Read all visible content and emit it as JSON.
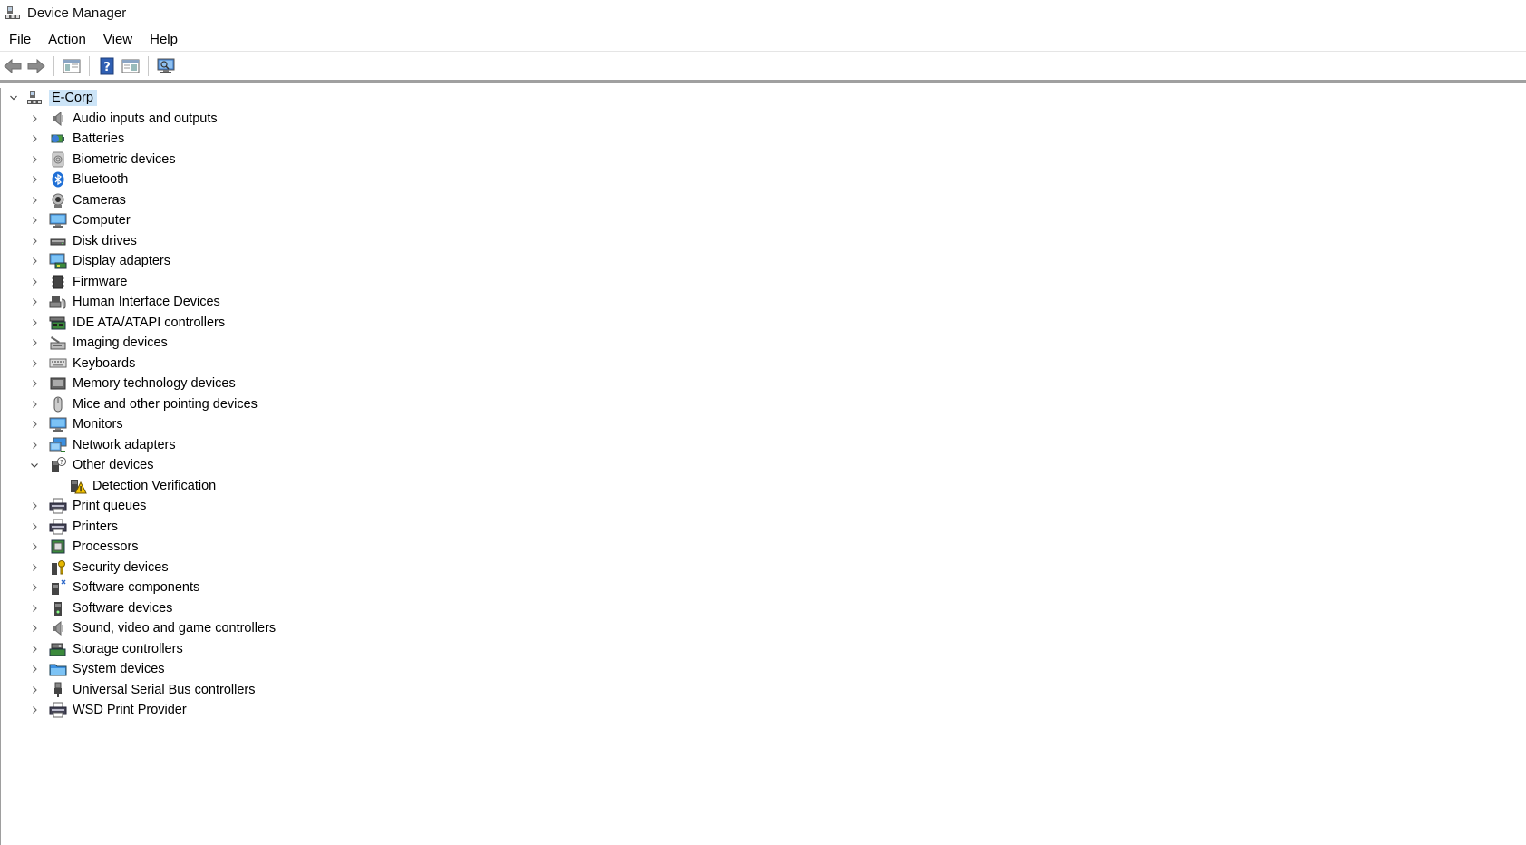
{
  "window": {
    "title": "Device Manager"
  },
  "menu": [
    "File",
    "Action",
    "View",
    "Help"
  ],
  "toolbar": {
    "buttons": [
      "back-icon",
      "forward-icon",
      "show-hide-console-tree-icon",
      "help-icon",
      "properties-icon",
      "scan-hardware-icon"
    ]
  },
  "tree": {
    "root": {
      "label": "E-Corp",
      "expanded": true,
      "icon": "computer-network-icon"
    },
    "categories": [
      {
        "label": "Audio inputs and outputs",
        "icon": "speaker-icon",
        "expanded": false
      },
      {
        "label": "Batteries",
        "icon": "battery-icon",
        "expanded": false
      },
      {
        "label": "Biometric devices",
        "icon": "fingerprint-icon",
        "expanded": false
      },
      {
        "label": "Bluetooth",
        "icon": "bluetooth-icon",
        "expanded": false
      },
      {
        "label": "Cameras",
        "icon": "camera-icon",
        "expanded": false
      },
      {
        "label": "Computer",
        "icon": "monitor-icon",
        "expanded": false
      },
      {
        "label": "Disk drives",
        "icon": "disk-drive-icon",
        "expanded": false
      },
      {
        "label": "Display adapters",
        "icon": "display-adapter-icon",
        "expanded": false
      },
      {
        "label": "Firmware",
        "icon": "chip-icon",
        "expanded": false
      },
      {
        "label": "Human Interface Devices",
        "icon": "hid-icon",
        "expanded": false
      },
      {
        "label": "IDE ATA/ATAPI controllers",
        "icon": "ide-controller-icon",
        "expanded": false
      },
      {
        "label": "Imaging devices",
        "icon": "scanner-icon",
        "expanded": false
      },
      {
        "label": "Keyboards",
        "icon": "keyboard-icon",
        "expanded": false
      },
      {
        "label": "Memory technology devices",
        "icon": "memory-icon",
        "expanded": false
      },
      {
        "label": "Mice and other pointing devices",
        "icon": "mouse-icon",
        "expanded": false
      },
      {
        "label": "Monitors",
        "icon": "monitor-icon",
        "expanded": false
      },
      {
        "label": "Network adapters",
        "icon": "network-icon",
        "expanded": false
      },
      {
        "label": "Other devices",
        "icon": "unknown-device-icon",
        "expanded": true,
        "children": [
          {
            "label": "Detection Verification",
            "icon": "warning-device-icon"
          }
        ]
      },
      {
        "label": "Print queues",
        "icon": "printer-icon",
        "expanded": false
      },
      {
        "label": "Printers",
        "icon": "printer-icon",
        "expanded": false
      },
      {
        "label": "Processors",
        "icon": "processor-icon",
        "expanded": false
      },
      {
        "label": "Security devices",
        "icon": "security-key-icon",
        "expanded": false
      },
      {
        "label": "Software components",
        "icon": "software-component-icon",
        "expanded": false
      },
      {
        "label": "Software devices",
        "icon": "software-device-icon",
        "expanded": false
      },
      {
        "label": "Sound, video and game controllers",
        "icon": "speaker-icon",
        "expanded": false
      },
      {
        "label": "Storage controllers",
        "icon": "storage-controller-icon",
        "expanded": false
      },
      {
        "label": "System devices",
        "icon": "system-folder-icon",
        "expanded": false
      },
      {
        "label": "Universal Serial Bus controllers",
        "icon": "usb-icon",
        "expanded": false
      },
      {
        "label": "WSD Print Provider",
        "icon": "printer-icon",
        "expanded": false
      }
    ]
  },
  "colors": {
    "selection": "#cce4f7",
    "separator": "#a0a0a0"
  }
}
